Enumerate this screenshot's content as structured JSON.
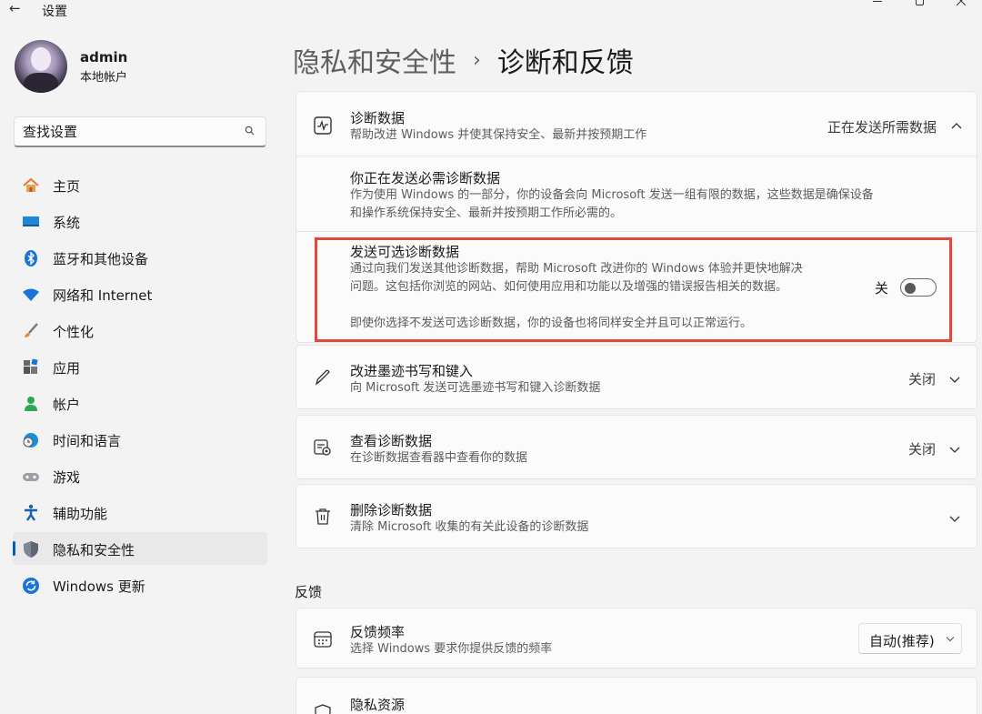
{
  "window": {
    "title": "设置",
    "back_glyph": "←"
  },
  "profile": {
    "name": "admin",
    "account_type": "本地帐户"
  },
  "search": {
    "placeholder": "查找设置"
  },
  "sidebar": {
    "items": [
      {
        "label": "主页",
        "icon": "home-icon",
        "active": false
      },
      {
        "label": "系统",
        "icon": "system-icon",
        "active": false
      },
      {
        "label": "蓝牙和其他设备",
        "icon": "bluetooth-icon",
        "active": false
      },
      {
        "label": "网络和 Internet",
        "icon": "wifi-icon",
        "active": false
      },
      {
        "label": "个性化",
        "icon": "brush-icon",
        "active": false
      },
      {
        "label": "应用",
        "icon": "apps-icon",
        "active": false
      },
      {
        "label": "帐户",
        "icon": "account-icon",
        "active": false
      },
      {
        "label": "时间和语言",
        "icon": "globe-clock-icon",
        "active": false
      },
      {
        "label": "游戏",
        "icon": "gamepad-icon",
        "active": false
      },
      {
        "label": "辅助功能",
        "icon": "accessibility-icon",
        "active": false
      },
      {
        "label": "隐私和安全性",
        "icon": "shield-icon",
        "active": true
      },
      {
        "label": "Windows 更新",
        "icon": "update-icon",
        "active": false
      }
    ]
  },
  "breadcrumb": {
    "parent": "隐私和安全性",
    "separator": "›",
    "current": "诊断和反馈"
  },
  "diagnostic_data": {
    "title": "诊断数据",
    "description": "帮助改进 Windows 并使其保持安全、最新并按预期工作",
    "status": "正在发送所需数据",
    "required": {
      "title": "你正在发送必需诊断数据",
      "description_line1": "作为使用 Windows 的一部分，你的设备会向 Microsoft 发送一组有限的数据，这些数据是确保设备",
      "description_line2": "和操作系统保持安全、最新并按预期工作所必需的。"
    },
    "optional": {
      "title": "发送可选诊断数据",
      "description_line1": "通过向我们发送其他诊断数据，帮助 Microsoft 改进你的 Windows 体验并更快地解决",
      "description_line2": "问题。这包括你浏览的网站、如何使用应用和功能以及增强的错误报告相关的数据。",
      "toggle_state": "关",
      "toggle_on": false,
      "note": "即使你选择不发送可选诊断数据，你的设备也将同样安全并且可以正常运行。"
    }
  },
  "inking": {
    "title": "改进墨迹书写和键入",
    "description": "向 Microsoft 发送可选墨迹书写和键入诊断数据",
    "value": "关闭"
  },
  "view_data": {
    "title": "查看诊断数据",
    "description": "在诊断数据查看器中查看你的数据",
    "value": "关闭"
  },
  "delete_data": {
    "title": "删除诊断数据",
    "description": "清除 Microsoft 收集的有关此设备的诊断数据"
  },
  "feedback": {
    "section_title": "反馈",
    "frequency": {
      "title": "反馈频率",
      "description": "选择 Windows 要求你提供反馈的频率",
      "selected": "自动(推荐)"
    },
    "privacy_resources": {
      "title": "隐私资源"
    }
  },
  "colors": {
    "accent": "#005fb8",
    "highlight_border": "#e2493a",
    "background": "#f3f3f3",
    "card": "#fbfbfb"
  }
}
